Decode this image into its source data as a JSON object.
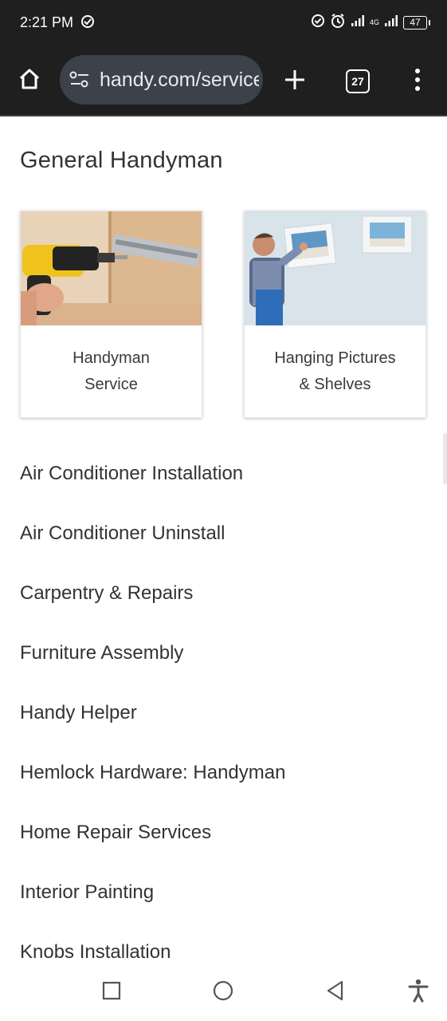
{
  "status_bar": {
    "time": "2:21 PM",
    "network": "4G",
    "battery": "47"
  },
  "browser": {
    "url": "handy.com/services",
    "tab_count": "27"
  },
  "page": {
    "title": "General Handyman",
    "cards": [
      {
        "label_line1": "Handyman",
        "label_line2": "Service",
        "image": "drill-drawer-photo"
      },
      {
        "label_line1": "Hanging Pictures",
        "label_line2": "& Shelves",
        "image": "hanging-pictures-photo"
      }
    ],
    "services": [
      "Air Conditioner Installation",
      "Air Conditioner Uninstall",
      "Carpentry & Repairs",
      "Furniture Assembly",
      "Handy Helper",
      "Hemlock Hardware: Handyman",
      "Home Repair Services",
      "Interior Painting",
      "Knobs Installation"
    ]
  },
  "icons": {
    "home": "home-icon",
    "site_settings": "tune-icon",
    "new_tab": "plus-icon",
    "menu": "more-vertical-icon",
    "nav_recents": "square-icon",
    "nav_home": "circle-icon",
    "nav_back": "triangle-back-icon",
    "accessibility": "accessibility-icon"
  },
  "colors": {
    "toolbar_bg": "#1f1f1f",
    "url_pill_bg": "#3c4249",
    "text_primary": "#333333"
  }
}
